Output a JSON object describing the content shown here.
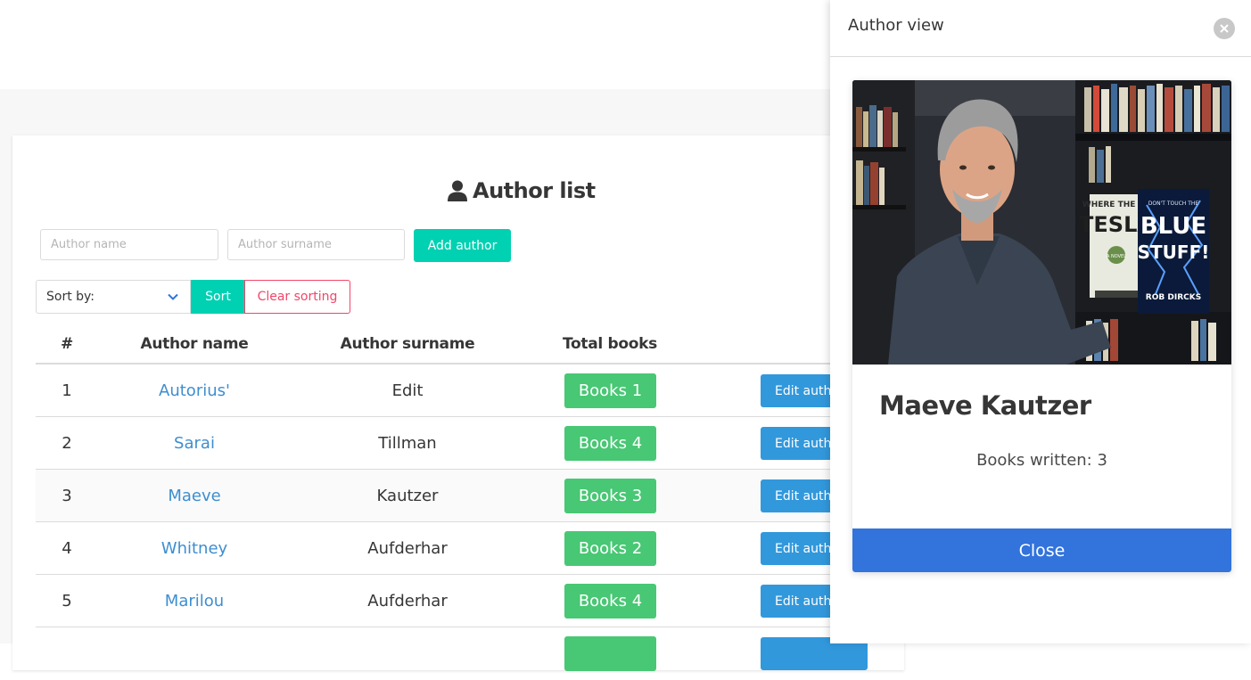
{
  "author_list": {
    "title": "Author list",
    "title_icon": "user-icon",
    "inputs": {
      "name_placeholder": "Author name",
      "surname_placeholder": "Author surname"
    },
    "add_button": "Add author",
    "sort": {
      "select_value": "Sort by:",
      "sort_button": "Sort",
      "clear_button": "Clear sorting"
    },
    "columns": {
      "num": "#",
      "name": "Author name",
      "surname": "Author surname",
      "total": "Total books"
    },
    "rows": [
      {
        "num": "1",
        "name": "Autorius'",
        "surname": "Edit",
        "books": "Books 1",
        "edit": "Edit author"
      },
      {
        "num": "2",
        "name": "Sarai",
        "surname": "Tillman",
        "books": "Books 4",
        "edit": "Edit author"
      },
      {
        "num": "3",
        "name": "Maeve",
        "surname": "Kautzer",
        "books": "Books 3",
        "edit": "Edit author"
      },
      {
        "num": "4",
        "name": "Whitney",
        "surname": "Aufderhar",
        "books": "Books 2",
        "edit": "Edit author"
      },
      {
        "num": "5",
        "name": "Marilou",
        "surname": "Aufderhar",
        "books": "Books 4",
        "edit": "Edit author"
      }
    ]
  },
  "author_view": {
    "title": "Author view",
    "name": "Maeve Kautzer",
    "books_written": "Books written: 3",
    "close_button": "Close",
    "photo_book_titles": [
      "WHERE THE HE",
      "TESLA",
      "A NOVEL",
      "DON'T TOUCH THE",
      "BLUE",
      "STUFF!",
      "ROB DIRCKS"
    ]
  },
  "colors": {
    "primary": "#00d1b2",
    "danger": "#f14668",
    "success": "#48c774",
    "info": "#3298dc",
    "link": "#3e8ed0",
    "close": "#3273dc"
  }
}
